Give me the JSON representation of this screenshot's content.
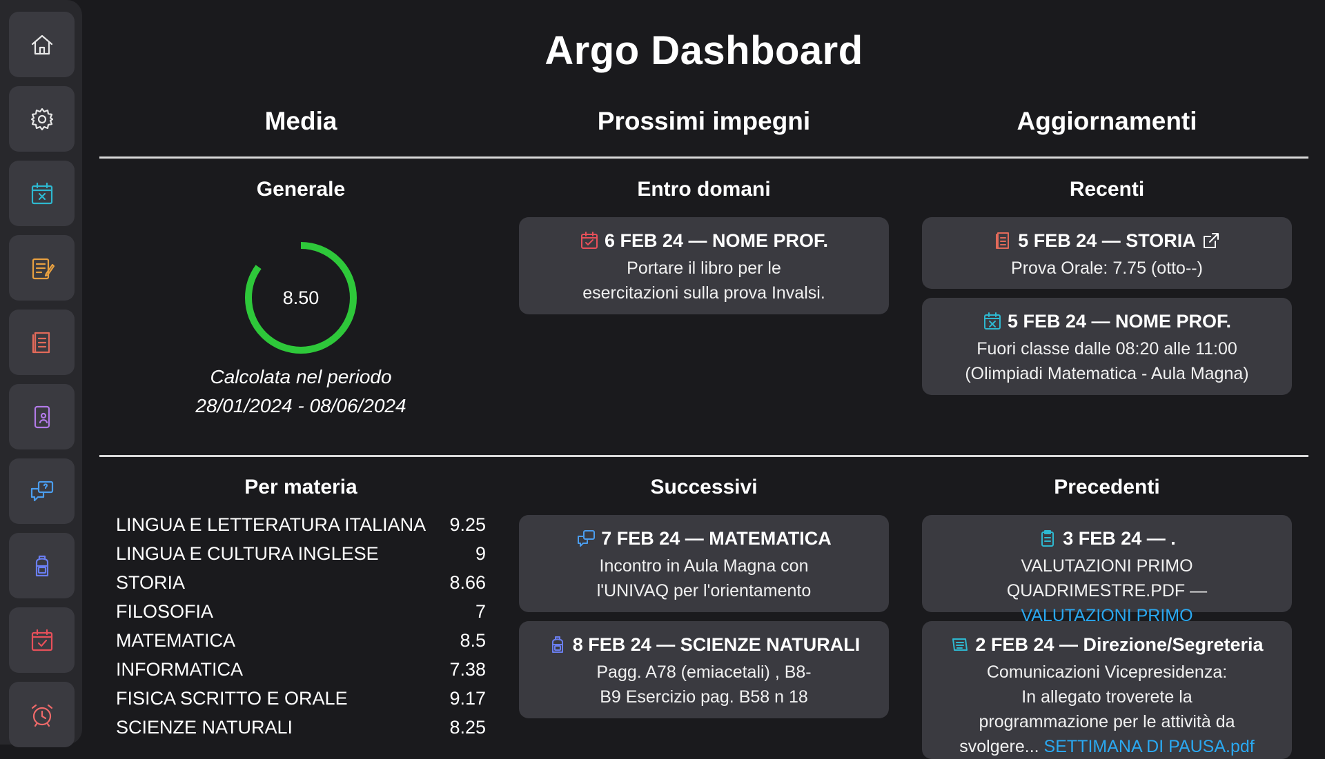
{
  "sidebar": {
    "items": [
      {
        "icon": "home-icon",
        "color": "#e8e8e8"
      },
      {
        "icon": "gear-icon",
        "color": "#e8e8e8"
      },
      {
        "icon": "calendar-x-icon",
        "color": "#2eb8d0"
      },
      {
        "icon": "notes-pen-icon",
        "color": "#e8a040"
      },
      {
        "icon": "book-icon",
        "color": "#e26a5a"
      },
      {
        "icon": "phone-user-icon",
        "color": "#b27ae8"
      },
      {
        "icon": "chat-question-icon",
        "color": "#4b9ef0"
      },
      {
        "icon": "backpack-icon",
        "color": "#6a7ef0"
      },
      {
        "icon": "calendar-check-icon",
        "color": "#e8505a"
      },
      {
        "icon": "alarm-clock-icon",
        "color": "#f06a6a"
      }
    ]
  },
  "title": "Argo Dashboard",
  "columns": {
    "media": "Media",
    "impegni": "Prossimi impegni",
    "aggiornamenti": "Aggiornamenti"
  },
  "media": {
    "generale_title": "Generale",
    "average": "8.50",
    "average_fraction": 0.85,
    "gauge_color": "#2ec83a",
    "period_label": "Calcolata nel periodo",
    "period_range": "28/01/2024 - 08/06/2024",
    "per_materia_title": "Per materia",
    "subjects": [
      {
        "name": "LINGUA E LETTERATURA ITALIANA",
        "value": "9.25"
      },
      {
        "name": "LINGUA E CULTURA INGLESE",
        "value": "9"
      },
      {
        "name": "STORIA",
        "value": "8.66"
      },
      {
        "name": "FILOSOFIA",
        "value": "7"
      },
      {
        "name": "MATEMATICA",
        "value": "8.5"
      },
      {
        "name": "INFORMATICA",
        "value": "7.38"
      },
      {
        "name": "FISICA SCRITTO E ORALE",
        "value": "9.17"
      },
      {
        "name": "SCIENZE NATURALI",
        "value": "8.25"
      }
    ]
  },
  "impegni": {
    "entro_title": "Entro domani",
    "entro": [
      {
        "title": "6 FEB 24 — NOME PROF.",
        "body": [
          "Portare il libro per le",
          "esercitazioni sulla prova Invalsi."
        ],
        "icon": "calendar-check-icon"
      }
    ],
    "successivi_title": "Successivi",
    "successivi": [
      {
        "title": "7 FEB 24 — MATEMATICA",
        "body": [
          "Incontro in Aula Magna con",
          "l'UNIVAQ per l'orientamento"
        ],
        "icon": "chat-question-icon"
      },
      {
        "title": "8 FEB 24 — SCIENZE NATURALI",
        "body": [
          "Pagg. A78 (emiacetali) , B8-",
          "B9 Esercizio pag. B58 n 18"
        ],
        "icon": "backpack-icon"
      }
    ]
  },
  "aggiornamenti": {
    "recenti_title": "Recenti",
    "recenti": [
      {
        "title": "5 FEB 24 — STORIA",
        "body": [
          "Prova Orale: 7.75 (otto--)"
        ],
        "icon": "book-icon",
        "extra_icon": "external-link-icon"
      },
      {
        "title": "5 FEB 24 — NOME PROF.",
        "body": [
          "Fuori classe dalle 08:20 alle 11:00",
          "(Olimpiadi Matematica - Aula Magna)"
        ],
        "icon": "calendar-x-icon"
      }
    ],
    "precedenti_title": "Precedenti",
    "precedenti": [
      {
        "title": "3 FEB 24 — .",
        "body": [
          "VALUTAZIONI PRIMO QUADRIMESTRE.PDF —"
        ],
        "link": "VALUTAZIONI PRIMO QUADRIMESTRE.PDF",
        "icon": "clipboard-icon"
      },
      {
        "title": "2 FEB 24 — Direzione/Segreteria",
        "body": [
          "Comunicazioni Vicepresidenza:",
          "In allegato troverete la",
          "programmazione per le attività da",
          "svolgere..."
        ],
        "link": "SETTIMANA DI PAUSA.pdf",
        "icon": "notice-board-icon"
      }
    ]
  }
}
